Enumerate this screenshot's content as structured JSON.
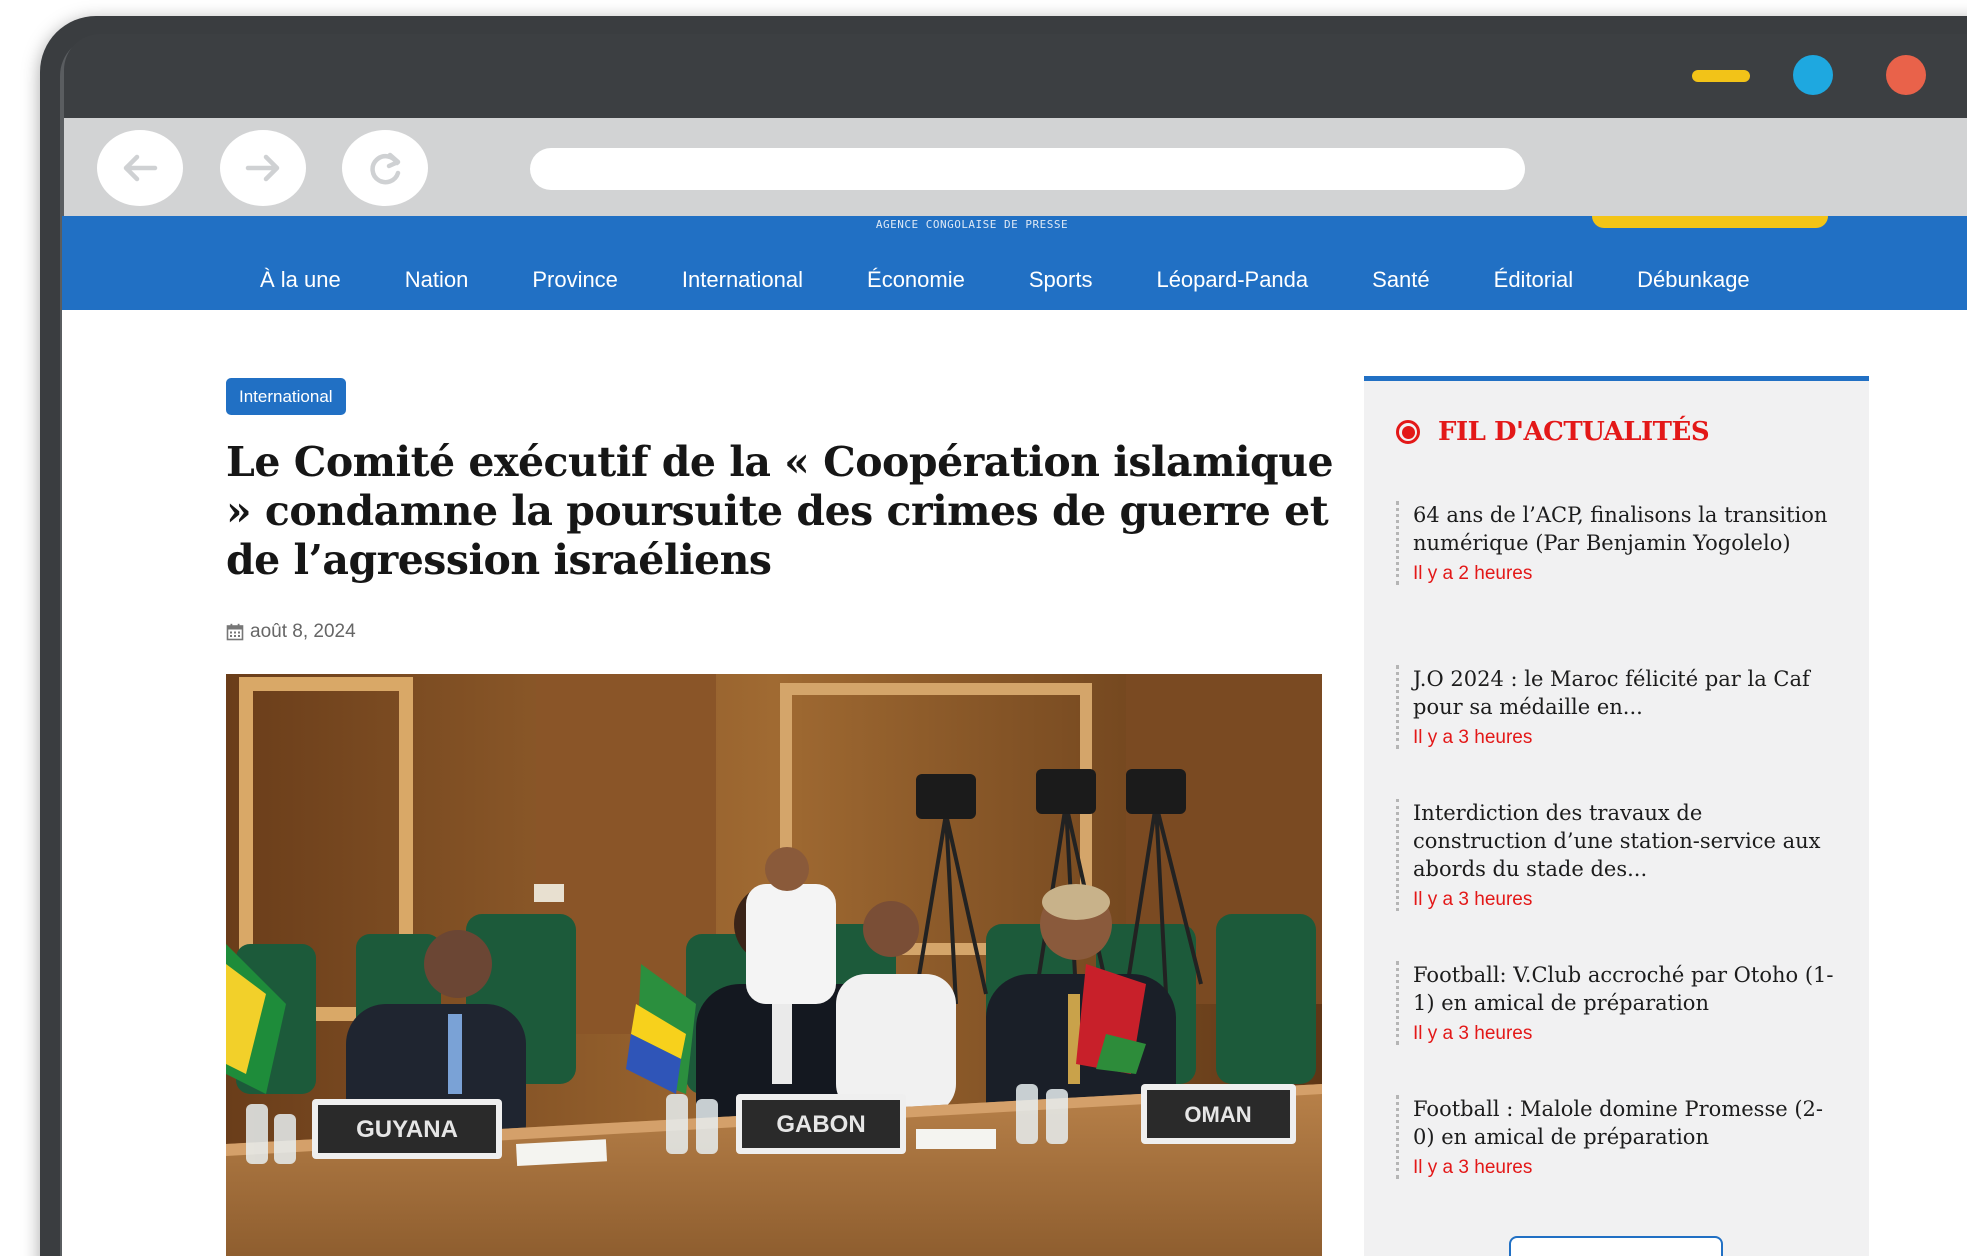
{
  "site": {
    "tagline": "AGENCE CONGOLAISE DE PRESSE"
  },
  "nav": {
    "items": [
      {
        "label": "À la une"
      },
      {
        "label": "Nation"
      },
      {
        "label": "Province"
      },
      {
        "label": "International"
      },
      {
        "label": "Économie"
      },
      {
        "label": "Sports"
      },
      {
        "label": "Léopard-Panda"
      },
      {
        "label": "Santé"
      },
      {
        "label": "Éditorial"
      },
      {
        "label": "Débunkage"
      }
    ]
  },
  "article": {
    "category": "International",
    "title": "Le Comité exécutif de la « Coopération islamique » condamne la poursuite des crimes de guerre et de l’agression israéliens",
    "date": "août 8, 2024",
    "image": {
      "placards": [
        "GUYANA",
        "GABON",
        "OMAN"
      ]
    }
  },
  "sidebar": {
    "title": "FIL D'ACTUALITÉS",
    "items": [
      {
        "title": "64 ans de l’ACP, finalisons la transition numérique (Par Benjamin Yogolelo)",
        "time": "Il y a 2 heures"
      },
      {
        "title": "J.O 2024 : le Maroc félicité par la Caf pour sa médaille en...",
        "time": "Il y a 3 heures"
      },
      {
        "title": "Interdiction des travaux de construction d’une station-service aux abords du stade des...",
        "time": "Il y a 3 heures"
      },
      {
        "title": "Football: V.Club accroché par Otoho (1-1) en amical de préparation",
        "time": "Il y a 3 heures"
      },
      {
        "title": "Football : Malole domine Promesse (2-0) en amical de préparation",
        "time": "Il y a 3 heures"
      }
    ]
  },
  "colors": {
    "brand_blue": "#2170c4",
    "alert_red": "#e31818",
    "accent_yellow": "#f3c416"
  },
  "icons": {
    "back": "arrow-left-icon",
    "forward": "arrow-right-icon",
    "reload": "reload-icon",
    "date": "calendar-icon"
  }
}
